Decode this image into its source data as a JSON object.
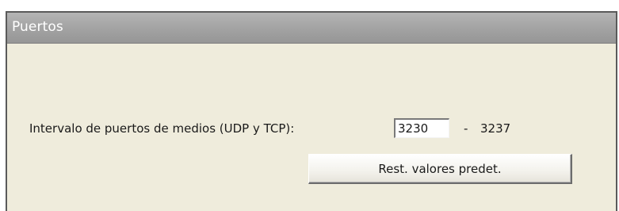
{
  "panel": {
    "title": "Puertos"
  },
  "ports": {
    "label": "Intervalo de puertos de medios (UDP y TCP):",
    "start_value": "3230",
    "separator": "-",
    "end_value": "3237"
  },
  "actions": {
    "reset_label": "Rest. valores predet."
  }
}
